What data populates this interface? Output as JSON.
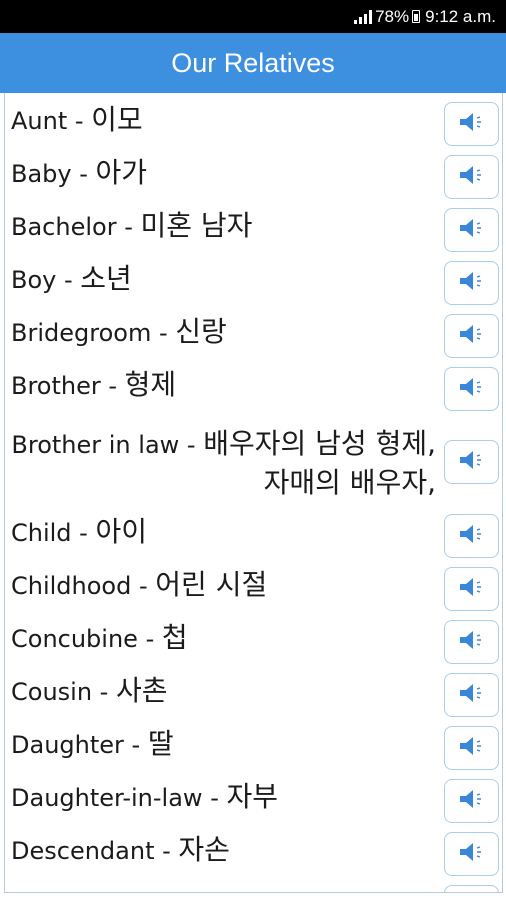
{
  "status_bar": {
    "battery": "78%",
    "time": "9:12 a.m."
  },
  "header": {
    "title": "Our Relatives"
  },
  "colors": {
    "header": "#3d8fe0",
    "button_border": "#a9cdea",
    "speaker_icon": "#3a86d8"
  },
  "items": [
    {
      "english": "Aunt",
      "korean": "이모"
    },
    {
      "english": "Baby",
      "korean": "아가"
    },
    {
      "english": "Bachelor",
      "korean": "미혼 남자"
    },
    {
      "english": "Boy",
      "korean": "소년"
    },
    {
      "english": "Bridegroom",
      "korean": "신랑"
    },
    {
      "english": "Brother",
      "korean": "형제"
    },
    {
      "english": "Brother in law",
      "korean": "배우자의 남성 형제, 자매의 배우자,"
    },
    {
      "english": "Child",
      "korean": "아이"
    },
    {
      "english": "Childhood",
      "korean": "어린 시절"
    },
    {
      "english": "Concubine",
      "korean": "첩"
    },
    {
      "english": "Cousin",
      "korean": "사촌"
    },
    {
      "english": "Daughter",
      "korean": "딸"
    },
    {
      "english": "Daughter-in-law",
      "korean": "자부"
    },
    {
      "english": "Descendant",
      "korean": "자손"
    },
    {
      "english": "",
      "korean": ""
    }
  ],
  "separator": " - ",
  "speaker_icon": "speaker-icon"
}
